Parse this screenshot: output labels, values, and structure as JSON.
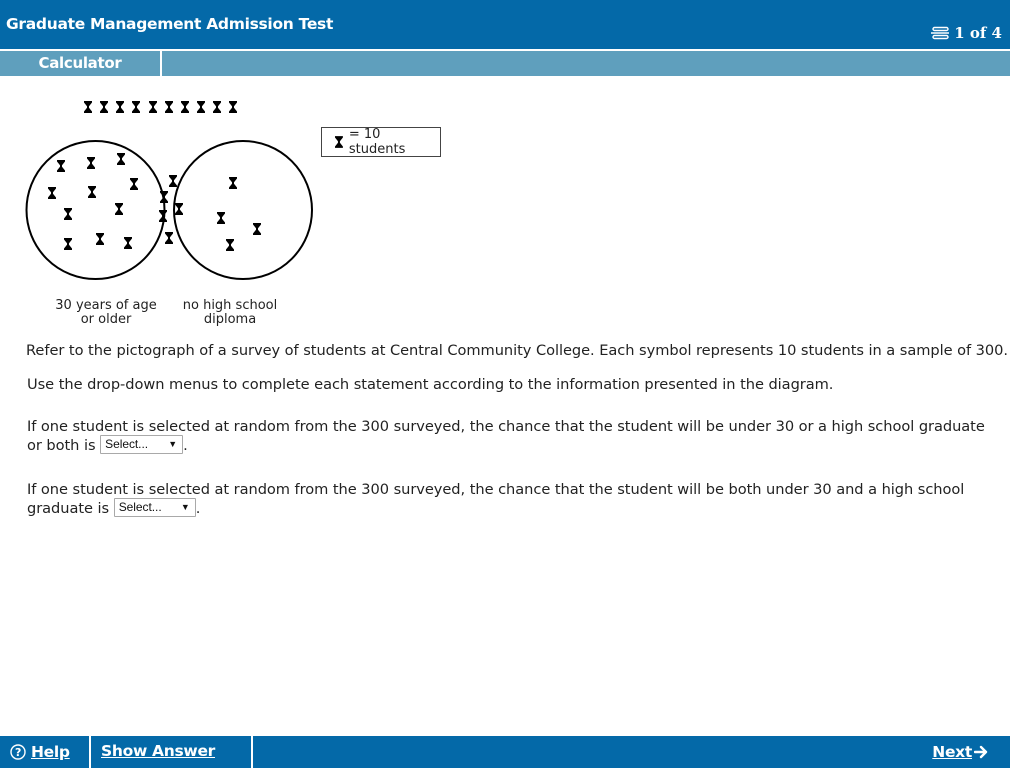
{
  "header": {
    "title": "Graduate Management Admission Test",
    "counter": "1 of 4",
    "counter_icon": "list-icon"
  },
  "toolbar": {
    "calculator_label": "Calculator"
  },
  "pictograph": {
    "legend_symbol": "hourglass-icon",
    "legend_text": "= 10 students",
    "students_per_symbol": 10,
    "left_set_label_line1": "30 years of age",
    "left_set_label_line2": "or older",
    "right_set_label_line1": "no high school",
    "right_set_label_line2": "diploma",
    "counts_in_symbols": {
      "outside_both": 10,
      "left_only": 11,
      "both": 5,
      "right_only": 4
    }
  },
  "content": {
    "intro": "Refer to the pictograph of a survey of students at Central Community College. Each symbol represents 10 students in a sample of 300.",
    "instructions": "Use the drop-down menus to complete each statement according to the information presented in the diagram.",
    "questions": [
      {
        "text": "If one student is selected at random from the 300 surveyed, the chance that the student will be under 30 or a high school graduate or both is ",
        "select_value": "Select...",
        "suffix": "."
      },
      {
        "text": "If one student is selected at random from the 300 surveyed, the chance that the student will be both under 30 and a high school graduate is ",
        "select_value": "Select...",
        "suffix": "."
      }
    ]
  },
  "footer": {
    "help_label": "Help",
    "help_icon": "help-circle-icon",
    "show_answer_label": "Show Answer",
    "next_label": "Next",
    "next_icon": "arrow-right-icon"
  },
  "colors": {
    "header_blue": "#0469a8",
    "toolbar_blue": "#5f9fbd"
  }
}
